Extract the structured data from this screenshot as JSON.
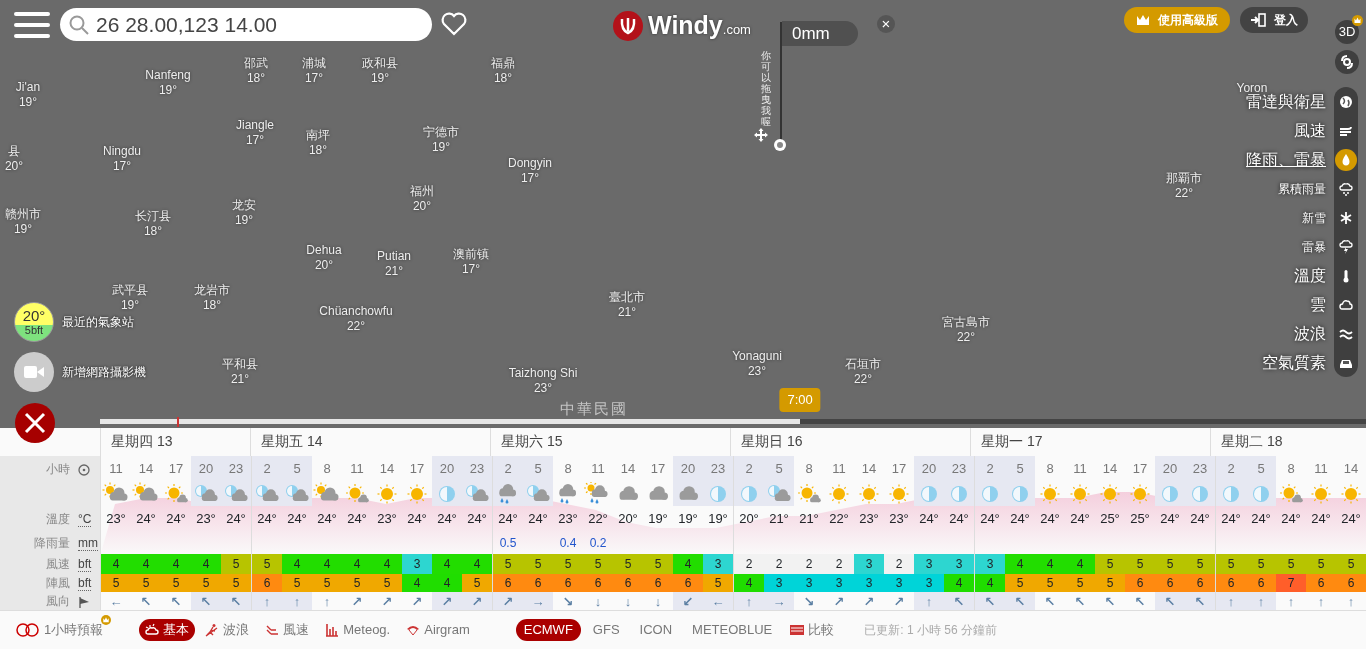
{
  "top_bar": {
    "search": {
      "value": "26 28.00,123 14.00"
    },
    "logo": {
      "name": "Windy",
      "suffix": ".com"
    },
    "premium_button": "使用高級版",
    "login_button": "登入"
  },
  "picker": {
    "value": "0mm",
    "close": "×",
    "hint": "你可以拖曳我喔"
  },
  "map_labels": [
    {
      "name": "Ji'an",
      "temp": "19°"
    },
    {
      "name": "Nanfeng",
      "temp": "19°"
    },
    {
      "name": "邵武",
      "temp": "18°"
    },
    {
      "name": "浦城",
      "temp": "17°"
    },
    {
      "name": "政和县",
      "temp": "19°"
    },
    {
      "name": "福鼎",
      "temp": "18°"
    },
    {
      "name": "Yoron"
    },
    {
      "name": "县",
      "temp": "20°"
    },
    {
      "name": "Ningdu",
      "temp": "17°"
    },
    {
      "name": "Jiangle",
      "temp": "17°"
    },
    {
      "name": "南坪",
      "temp": "18°"
    },
    {
      "name": "宁德市",
      "temp": "19°"
    },
    {
      "name": "Dongyin",
      "temp": "17°"
    },
    {
      "name": "赣州市",
      "temp": "19°"
    },
    {
      "name": "长汀县",
      "temp": "18°"
    },
    {
      "name": "龙安",
      "temp": "19°"
    },
    {
      "name": "福州",
      "temp": "20°"
    },
    {
      "name": "那覇市",
      "temp": "22°"
    },
    {
      "name": "Dehua",
      "temp": "20°"
    },
    {
      "name": "Putian",
      "temp": "21°"
    },
    {
      "name": "澳前镇",
      "temp": "17°"
    },
    {
      "name": "武平县",
      "temp": "19°"
    },
    {
      "name": "龙岩市",
      "temp": "18°"
    },
    {
      "name": "Chüanchowfu",
      "temp": "22°"
    },
    {
      "name": "臺北市",
      "temp": "21°"
    },
    {
      "name": "宮古島市",
      "temp": "22°"
    },
    {
      "name": "平和县",
      "temp": "21°"
    },
    {
      "name": "Taizhong Shi",
      "temp": "23°"
    },
    {
      "name": "Yonaguni",
      "temp": "23°"
    },
    {
      "name": "石垣市",
      "temp": "22°"
    }
  ],
  "country_label": "中華民國",
  "side_buttons": {
    "three_d": "3D"
  },
  "layers": [
    {
      "label": "雷達與衛星",
      "kind": "main",
      "selected": false
    },
    {
      "label": "風速",
      "kind": "main",
      "selected": false
    },
    {
      "label": "降雨、雷暴",
      "kind": "main",
      "selected": true
    },
    {
      "label": "累積雨量",
      "kind": "sub",
      "selected": false
    },
    {
      "label": "新雪",
      "kind": "sub",
      "selected": false
    },
    {
      "label": "雷暴",
      "kind": "sub",
      "selected": false
    },
    {
      "label": "溫度",
      "kind": "main",
      "selected": false
    },
    {
      "label": "雲",
      "kind": "main",
      "selected": false
    },
    {
      "label": "波浪",
      "kind": "main",
      "selected": false
    },
    {
      "label": "空氣質素",
      "kind": "main",
      "selected": false
    }
  ],
  "station": {
    "temp": "20°",
    "wind": "5bft",
    "label": "最近的氣象站"
  },
  "webcam": {
    "label": "新增網路攝影機"
  },
  "timeline": {
    "level": 0.553,
    "time": "7:00"
  },
  "forecast": {
    "row_labels": [
      {
        "label": "小時",
        "kind": "clock"
      },
      {
        "label": "溫度",
        "unit": "°C"
      },
      {
        "label": "降雨量",
        "unit": "mm"
      },
      {
        "label": "風速",
        "unit": "bft"
      },
      {
        "label": "陣風",
        "unit": "bft"
      },
      {
        "label": "風向",
        "kind": "flag"
      }
    ],
    "days": [
      {
        "label": "星期四 13",
        "hours": [
          {
            "hour": "11",
            "kind": "sun_cloud",
            "temp": "23°",
            "wind": "4",
            "gust": "5",
            "arrow": "←",
            "night": false
          },
          {
            "hour": "14",
            "kind": "sun_cloud",
            "temp": "24°",
            "wind": "4",
            "gust": "5",
            "arrow": "↖",
            "night": false
          },
          {
            "hour": "17",
            "kind": "sun_small_cloud",
            "temp": "24°",
            "wind": "4",
            "gust": "5",
            "arrow": "↖",
            "night": false
          },
          {
            "hour": "20",
            "kind": "moon_cloud",
            "temp": "23°",
            "wind": "4",
            "gust": "5",
            "arrow": "↖",
            "night": true
          },
          {
            "hour": "23",
            "kind": "moon_cloud",
            "temp": "24°",
            "wind": "5",
            "gust": "5",
            "arrow": "↖",
            "night": true
          }
        ]
      },
      {
        "label": "星期五 14",
        "hours": [
          {
            "hour": "2",
            "kind": "moon_cloud",
            "temp": "24°",
            "wind": "5",
            "gust": "6",
            "arrow": "↑",
            "night": true
          },
          {
            "hour": "5",
            "kind": "moon_cloud",
            "temp": "24°",
            "wind": "4",
            "gust": "5",
            "arrow": "↑",
            "night": true
          },
          {
            "hour": "8",
            "kind": "sun_cloud",
            "temp": "24°",
            "wind": "4",
            "gust": "5",
            "arrow": "↑",
            "night": false
          },
          {
            "hour": "11",
            "kind": "sun_small_cloud",
            "temp": "24°",
            "wind": "4",
            "gust": "5",
            "arrow": "↗",
            "night": false
          },
          {
            "hour": "14",
            "kind": "sun",
            "temp": "23°",
            "wind": "4",
            "gust": "5",
            "arrow": "↗",
            "night": false
          },
          {
            "hour": "17",
            "kind": "sun",
            "temp": "24°",
            "wind": "3",
            "gust": "4",
            "arrow": "↗",
            "night": false
          },
          {
            "hour": "20",
            "kind": "moon",
            "temp": "24°",
            "wind": "4",
            "gust": "4",
            "arrow": "↗",
            "night": true
          },
          {
            "hour": "23",
            "kind": "moon_cloud",
            "temp": "24°",
            "wind": "4",
            "gust": "5",
            "arrow": "↗",
            "night": true
          }
        ]
      },
      {
        "label": "星期六 15",
        "hours": [
          {
            "hour": "2",
            "kind": "cloud_rain",
            "temp": "24°",
            "rain": "0.5",
            "wind": "5",
            "gust": "6",
            "arrow": "↗",
            "night": true
          },
          {
            "hour": "5",
            "kind": "moon_cloud",
            "temp": "24°",
            "wind": "5",
            "gust": "6",
            "arrow": "→",
            "night": true
          },
          {
            "hour": "8",
            "kind": "cloud_rain",
            "temp": "23°",
            "rain": "0.4",
            "wind": "5",
            "gust": "6",
            "arrow": "↘",
            "night": false
          },
          {
            "hour": "11",
            "kind": "sun_cloud_rain",
            "temp": "22°",
            "rain": "0.2",
            "wind": "5",
            "gust": "6",
            "arrow": "↓",
            "night": false
          },
          {
            "hour": "14",
            "kind": "cloud",
            "temp": "20°",
            "wind": "5",
            "gust": "6",
            "arrow": "↓",
            "night": false
          },
          {
            "hour": "17",
            "kind": "cloud",
            "temp": "19°",
            "wind": "5",
            "gust": "6",
            "arrow": "↓",
            "night": false
          },
          {
            "hour": "20",
            "kind": "cloud",
            "temp": "19°",
            "wind": "4",
            "gust": "6",
            "arrow": "↙",
            "night": true
          },
          {
            "hour": "23",
            "kind": "moon",
            "temp": "19°",
            "wind": "3",
            "gust": "5",
            "arrow": "←",
            "night": true
          }
        ]
      },
      {
        "label": "星期日 16",
        "hours": [
          {
            "hour": "2",
            "kind": "moon",
            "temp": "20°",
            "wind": "2",
            "gust": "4",
            "arrow": "↑",
            "night": true
          },
          {
            "hour": "5",
            "kind": "moon_cloud",
            "temp": "21°",
            "wind": "2",
            "gust": "3",
            "arrow": "→",
            "night": true
          },
          {
            "hour": "8",
            "kind": "sun_small_cloud",
            "temp": "21°",
            "wind": "2",
            "gust": "3",
            "arrow": "↘",
            "night": false
          },
          {
            "hour": "11",
            "kind": "sun",
            "temp": "22°",
            "wind": "2",
            "gust": "3",
            "arrow": "↗",
            "night": false
          },
          {
            "hour": "14",
            "kind": "sun",
            "temp": "23°",
            "wind": "3",
            "gust": "3",
            "arrow": "↗",
            "night": false
          },
          {
            "hour": "17",
            "kind": "sun",
            "temp": "23°",
            "wind": "2",
            "gust": "3",
            "arrow": "↗",
            "night": false
          },
          {
            "hour": "20",
            "kind": "moon",
            "temp": "24°",
            "wind": "3",
            "gust": "3",
            "arrow": "↑",
            "night": true
          },
          {
            "hour": "23",
            "kind": "moon",
            "temp": "24°",
            "wind": "3",
            "gust": "4",
            "arrow": "↖",
            "night": true
          }
        ]
      },
      {
        "label": "星期一 17",
        "hours": [
          {
            "hour": "2",
            "kind": "moon",
            "temp": "24°",
            "wind": "3",
            "gust": "4",
            "arrow": "↖",
            "night": true
          },
          {
            "hour": "5",
            "kind": "moon",
            "temp": "24°",
            "wind": "4",
            "gust": "5",
            "arrow": "↖",
            "night": true
          },
          {
            "hour": "8",
            "kind": "sun",
            "temp": "24°",
            "wind": "4",
            "gust": "5",
            "arrow": "↖",
            "night": false
          },
          {
            "hour": "11",
            "kind": "sun",
            "temp": "24°",
            "wind": "4",
            "gust": "5",
            "arrow": "↖",
            "night": false
          },
          {
            "hour": "14",
            "kind": "sun",
            "temp": "25°",
            "wind": "5",
            "gust": "5",
            "arrow": "↖",
            "night": false
          },
          {
            "hour": "17",
            "kind": "sun",
            "temp": "25°",
            "wind": "5",
            "gust": "6",
            "arrow": "↖",
            "night": false
          },
          {
            "hour": "20",
            "kind": "moon",
            "temp": "24°",
            "wind": "5",
            "gust": "6",
            "arrow": "↖",
            "night": true
          },
          {
            "hour": "23",
            "kind": "moon",
            "temp": "24°",
            "wind": "5",
            "gust": "6",
            "arrow": "↖",
            "night": true
          }
        ]
      },
      {
        "label": "星期二 18",
        "hours": [
          {
            "hour": "2",
            "kind": "moon",
            "temp": "24°",
            "wind": "5",
            "gust": "6",
            "arrow": "↑",
            "night": true
          },
          {
            "hour": "5",
            "kind": "moon",
            "temp": "24°",
            "wind": "5",
            "gust": "6",
            "arrow": "↑",
            "night": true
          },
          {
            "hour": "8",
            "kind": "sun_small_cloud",
            "temp": "24°",
            "wind": "5",
            "gust": "7",
            "arrow": "↑",
            "night": false
          },
          {
            "hour": "11",
            "kind": "sun",
            "temp": "24°",
            "wind": "5",
            "gust": "6",
            "arrow": "↑",
            "night": false
          },
          {
            "hour": "14",
            "kind": "sun",
            "temp": "24°",
            "wind": "5",
            "gust": "6",
            "arrow": "↑",
            "night": false
          }
        ]
      }
    ]
  },
  "bottom_bar": {
    "hourly_toggle": {
      "label": "1小時預報",
      "on": false
    },
    "tabs": [
      {
        "label": "基本",
        "selected": true
      },
      {
        "label": "波浪",
        "selected": false
      },
      {
        "label": "風速",
        "selected": false
      },
      {
        "label": "Meteog.",
        "selected": false
      },
      {
        "label": "Airgram",
        "selected": false
      }
    ],
    "models": [
      {
        "label": "ECMWF",
        "selected": true
      },
      {
        "label": "GFS",
        "selected": false
      },
      {
        "label": "ICON",
        "selected": false
      },
      {
        "label": "METEOBLUE",
        "selected": false
      }
    ],
    "compare": "比較",
    "updated": "已更新: 1 小時 56 分鐘前"
  }
}
